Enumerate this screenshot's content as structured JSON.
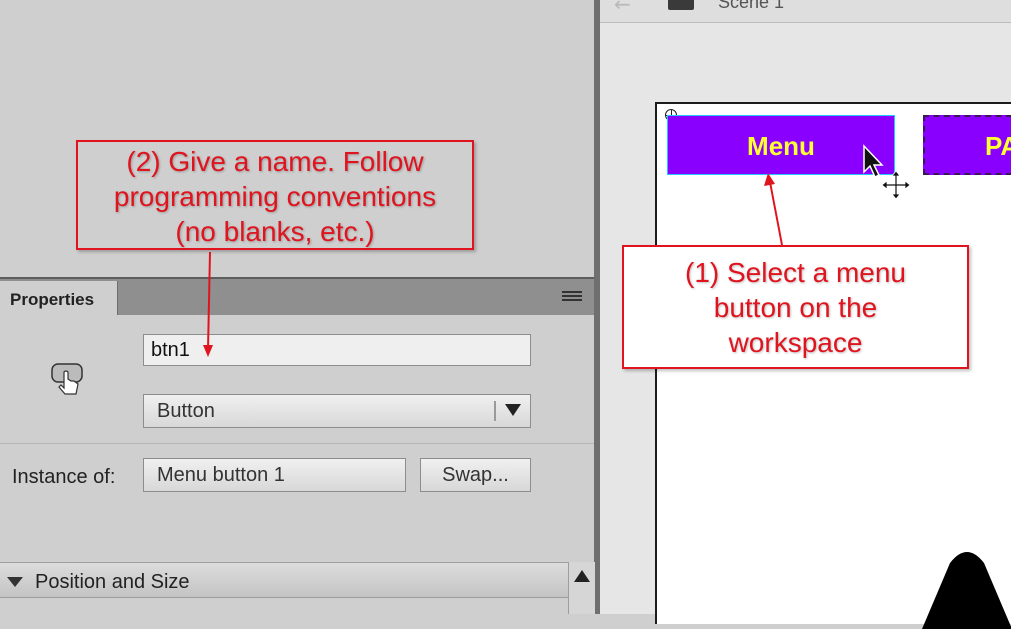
{
  "scene": {
    "label": "Scene 1"
  },
  "stage": {
    "menu_button_label": "Menu",
    "second_button_label": "PA"
  },
  "properties": {
    "tab_label": "Properties",
    "instance_name_value": "btn1",
    "symbol_type_value": "Button",
    "instance_of_label": "Instance of:",
    "instance_of_value": "Menu button 1",
    "swap_label": "Swap...",
    "position_section_label": "Position and Size"
  },
  "annotations": {
    "step2_lines": [
      "(2) Give a name. Follow",
      "programming conventions",
      "(no blanks, etc.)"
    ],
    "step1_lines": [
      "(1) Select a menu",
      "button on the",
      "workspace"
    ]
  },
  "colors": {
    "annotation_red": "#e0141e",
    "menu_button_fill": "#8a00ff",
    "menu_button_text": "#ffff33"
  }
}
